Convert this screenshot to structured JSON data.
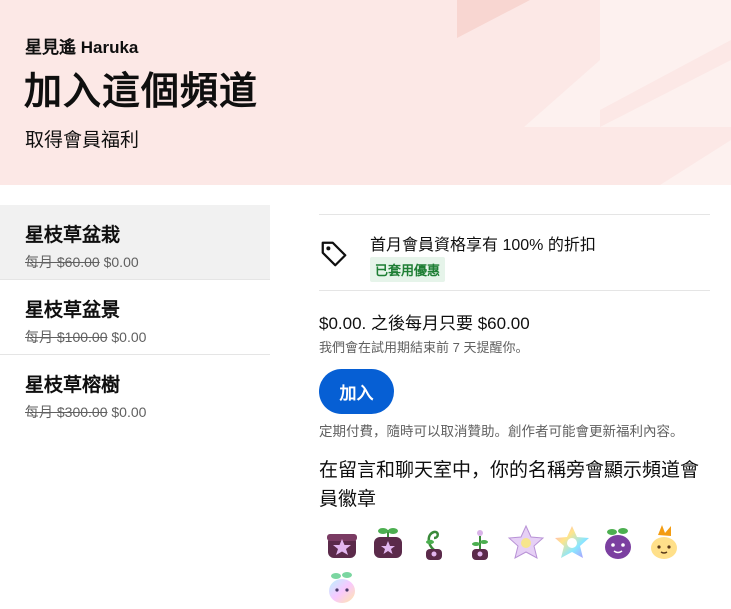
{
  "header": {
    "channel_name": "星見遙 Haruka",
    "title": "加入這個頻道",
    "subtitle": "取得會員福利"
  },
  "tiers": [
    {
      "name": "星枝草盆栽",
      "old_price": "每月 $60.00",
      "price": "$0.00",
      "selected": true
    },
    {
      "name": "星枝草盆景",
      "old_price": "每月 $100.00",
      "price": "$0.00",
      "selected": false
    },
    {
      "name": "星枝草榕樹",
      "old_price": "每月 $300.00",
      "price": "$0.00",
      "selected": false
    }
  ],
  "promo": {
    "text": "首月會員資格享有 100% 的折扣",
    "badge": "已套用優惠",
    "icon": "tag-icon"
  },
  "pricing": {
    "line": "$0.00. 之後每月只要 $60.00",
    "reminder": "我們會在試用期結束前 7 天提醒你。"
  },
  "join_button": {
    "label": "加入"
  },
  "terms": "定期付費，隨時可以取消贊助。創作者可能會更新福利內容。",
  "perk": {
    "title": "在留言和聊天室中，你的名稱旁會顯示頻道會員徽章",
    "badges": [
      "pot-star-badge",
      "pot-sprout-badge",
      "sprout-curl-badge",
      "sprout-small-badge",
      "star-flower-badge",
      "rainbow-flower-badge",
      "purple-plant-badge",
      "yellow-plant-badge",
      "rainbow-plant-badge"
    ]
  },
  "colors": {
    "header_bg": "#fce8e6",
    "accent": "#065fd4",
    "badge_green": "#1e7e34"
  }
}
